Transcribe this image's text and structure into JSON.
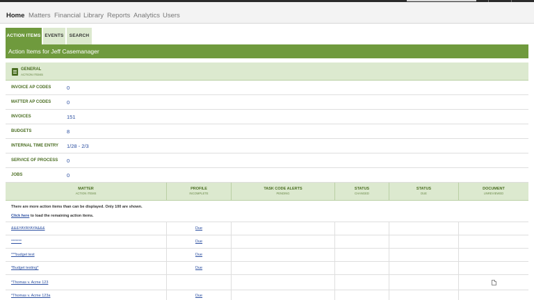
{
  "nav": {
    "items": [
      {
        "label": "Home",
        "active": true
      },
      {
        "label": "Matters",
        "active": false
      },
      {
        "label": "Financial",
        "active": false
      },
      {
        "label": "Library",
        "active": false
      },
      {
        "label": "Reports",
        "active": false
      },
      {
        "label": "Analytics",
        "active": false
      },
      {
        "label": "Users",
        "active": false
      }
    ]
  },
  "tabs": [
    {
      "label": "ACTION ITEMS",
      "active": true
    },
    {
      "label": "EVENTS",
      "active": false
    },
    {
      "label": "SEARCH",
      "active": false
    }
  ],
  "band": {
    "title": "Action Items for Jeff Casemanager"
  },
  "general": {
    "title": "GENERAL",
    "subtitle": "ACTION ITEMS",
    "icon": "list-icon"
  },
  "summary": [
    {
      "label": "INVOICE AP CODES",
      "value": "0"
    },
    {
      "label": "MATTER AP CODES",
      "value": "0"
    },
    {
      "label": "INVOICES",
      "value": "151"
    },
    {
      "label": "BUDGETS",
      "value": "8"
    },
    {
      "label": "INTERNAL TIME ENTRY",
      "value": "1/28 - 2/3"
    },
    {
      "label": "SERVICE OF PROCESS",
      "value": "0"
    },
    {
      "label": "JOBS",
      "value": "0"
    }
  ],
  "table": {
    "columns": [
      {
        "title": "MATTER",
        "subtitle": "ACTION ITEMS"
      },
      {
        "title": "PROFILE",
        "subtitle": "INCOMPLETE"
      },
      {
        "title": "TASK CODE ALERTS",
        "subtitle": "PENDING"
      },
      {
        "title": "STATUS",
        "subtitle": "CHANGED"
      },
      {
        "title": "STATUS",
        "subtitle": "DUE"
      },
      {
        "title": "DOCUMENT",
        "subtitle": "UNREVIEWED"
      }
    ],
    "notice": {
      "text": "There are more action items than can be displayed. Only 100 are shown.",
      "link": "Click here",
      "link_suffix": " to load the remaining action items."
    },
    "rows": [
      {
        "matter": "&&&YAYAYAYA&&&",
        "profile": "Due",
        "document_icon": false
      },
      {
        "matter": "*******",
        "profile": "Due",
        "document_icon": false
      },
      {
        "matter": "***budget test",
        "profile": "Due",
        "document_icon": false
      },
      {
        "matter": "*Budget testing*",
        "profile": "Due",
        "document_icon": false
      },
      {
        "matter": "*Thomas v. Acme 123",
        "profile": "",
        "document_icon": true
      },
      {
        "matter": "*Thomas v. Acme 123a",
        "profile": "Due",
        "document_icon": false
      }
    ]
  }
}
